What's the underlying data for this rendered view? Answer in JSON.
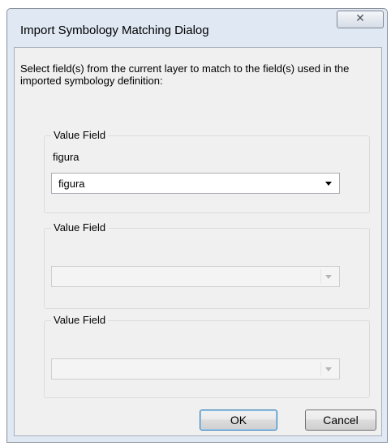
{
  "window": {
    "title": "Import Symbology Matching Dialog",
    "close_glyph": "✕"
  },
  "instructions": "Select field(s) from the current layer to match to the field(s) used in the imported symbology definition:",
  "groups": [
    {
      "legend": "Value Field",
      "sublabel": "figura",
      "combo_value": "figura",
      "enabled": true
    },
    {
      "legend": "Value Field",
      "sublabel": "",
      "combo_value": "",
      "enabled": false
    },
    {
      "legend": "Value Field",
      "sublabel": "",
      "combo_value": "",
      "enabled": false
    }
  ],
  "buttons": {
    "ok_label": "OK",
    "cancel_label": "Cancel"
  }
}
